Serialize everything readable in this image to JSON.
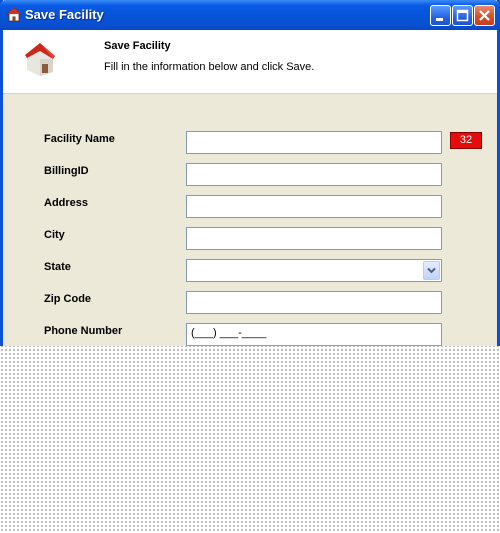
{
  "window": {
    "title": "Save Facility"
  },
  "header": {
    "title": "Save Facility",
    "subtitle": "Fill in the information below and click Save."
  },
  "form": {
    "facility_name": {
      "label": "Facility Name",
      "value": "",
      "char_limit": "32"
    },
    "billing_id": {
      "label": "BillingID",
      "value": ""
    },
    "address": {
      "label": "Address",
      "value": ""
    },
    "city": {
      "label": "City",
      "value": ""
    },
    "state": {
      "label": "State",
      "value": ""
    },
    "zip_code": {
      "label": "Zip Code",
      "value": ""
    },
    "phone_number": {
      "label": "Phone Number",
      "value": "(___) ___-____"
    }
  },
  "colors": {
    "title_bar": "#0453d6",
    "dialog_background": "#ece9d8",
    "char_limit_badge": "#e50c0c"
  },
  "icons": {
    "title": "house-icon",
    "header": "house-icon",
    "state_dropdown": "chevron-down-icon"
  }
}
